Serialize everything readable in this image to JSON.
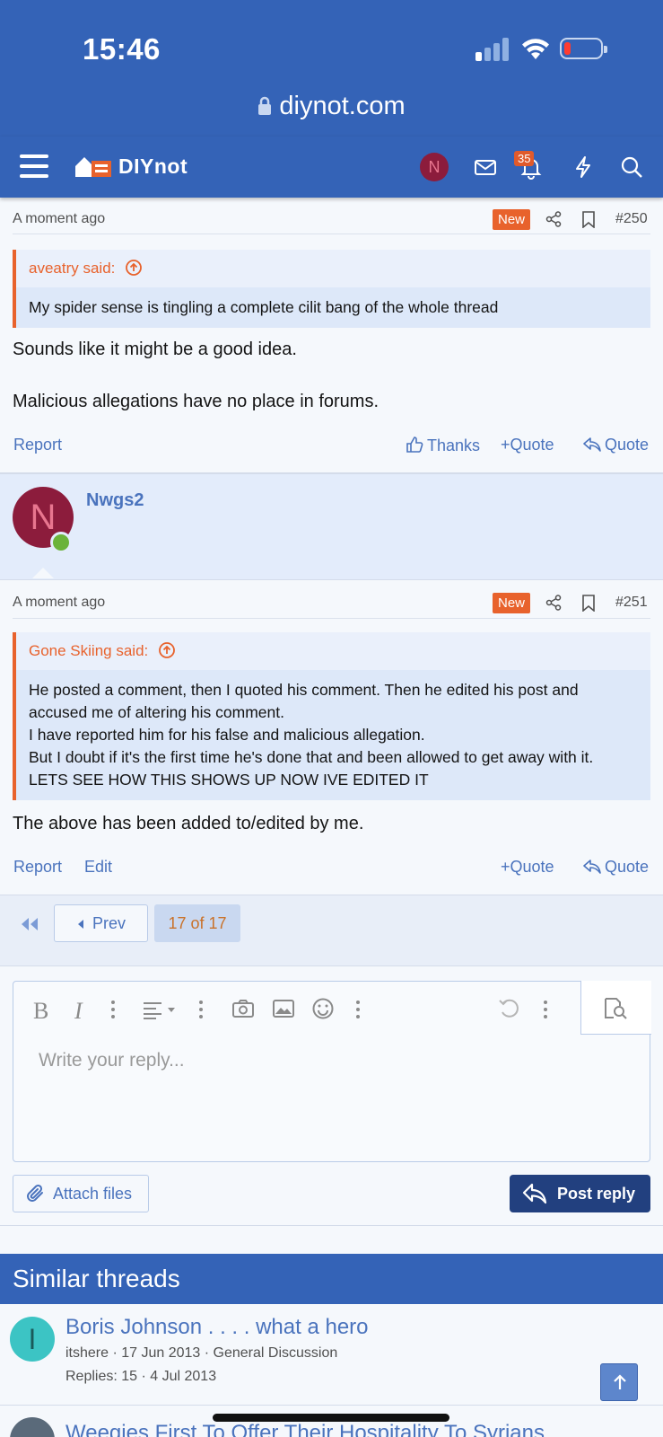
{
  "status_bar": {
    "time": "15:46"
  },
  "browser": {
    "url": "diynot.com"
  },
  "nav": {
    "logo": "DIYnot",
    "user_initial": "N",
    "alert_count": "35"
  },
  "post_250": {
    "time": "A moment ago",
    "new_badge": "New",
    "number": "#250",
    "quote_author": "aveatry said:",
    "quote_text": "My spider sense is tingling a complete cilit bang of the whole thread",
    "body_line1": "Sounds like it might be a good idea.",
    "body_line2": "Malicious allegations have no place in forums.",
    "report": "Report",
    "thanks": "Thanks",
    "multiquote": "Quote",
    "quote": "Quote"
  },
  "post_251": {
    "author": "Nwgs2",
    "author_initial": "N",
    "time": "A moment ago",
    "new_badge": "New",
    "number": "#251",
    "quote_author": "Gone Skiing said:",
    "quote_lines": [
      "He posted a comment, then I quoted his comment. Then he edited his post and",
      "accused me of altering his comment.",
      "I have reported him for his false and malicious allegation.",
      "But I doubt if it's the first time he's done that and been allowed to get away with it.",
      "LETS SEE HOW THIS SHOWS UP NOW IVE EDITED IT"
    ],
    "body": "The above has been added to/edited by me.",
    "report": "Report",
    "edit": "Edit",
    "multiquote": "Quote",
    "quote": "Quote"
  },
  "pagination": {
    "prev": "Prev",
    "indicator": "17 of 17"
  },
  "editor": {
    "placeholder": "Write your reply..."
  },
  "attach_label": "Attach files",
  "post_reply_label": "Post reply",
  "similar": {
    "heading": "Similar threads",
    "items": [
      {
        "initial": "I",
        "title": "Boris Johnson . . . . what a hero",
        "meta1": "itshere · 17 Jun 2013 · General Discussion",
        "meta2": "Replies: 15 · 4 Jul 2013"
      },
      {
        "title": "Weegies First To Offer Their Hospitality To Syrians"
      }
    ]
  },
  "colors": {
    "brand": "#3463b7",
    "accent": "#e8622c",
    "link": "#4a73bd",
    "button": "#22407f"
  }
}
